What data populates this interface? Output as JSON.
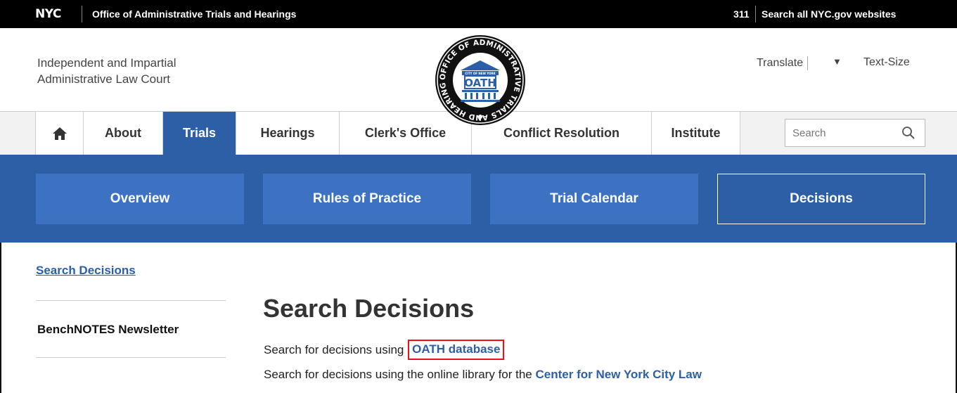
{
  "topbar": {
    "logo": "NYC",
    "agency": "Office of Administrative Trials and Hearings",
    "n311": "311",
    "search_all": "Search all NYC.gov websites"
  },
  "header": {
    "tagline_line1": "Independent and Impartial",
    "tagline_line2": "Administrative Law Court",
    "seal": {
      "ring_text": "OFFICE OF ADMINISTRATIVE TRIALS AND HEARINGS",
      "banner": "CITY OF NEW YORK",
      "center": "OATH"
    },
    "translate": "Translate",
    "translate_arrow": "▼",
    "text_size": "Text-Size"
  },
  "nav": {
    "home_icon": "home-icon",
    "items": [
      {
        "label": "About"
      },
      {
        "label": "Trials",
        "active": true
      },
      {
        "label": "Hearings"
      },
      {
        "label": "Clerk's Office"
      },
      {
        "label": "Conflict Resolution"
      },
      {
        "label": "Institute"
      }
    ],
    "search_placeholder": "Search",
    "search_icon": "magnifier-icon"
  },
  "subnav": {
    "items": [
      {
        "label": "Overview"
      },
      {
        "label": "Rules of Practice"
      },
      {
        "label": "Trial Calendar"
      },
      {
        "label": "Decisions",
        "selected": true
      }
    ]
  },
  "sidebar": {
    "link": "Search Decisions",
    "item": "BenchNOTES Newsletter"
  },
  "main": {
    "title": "Search Decisions",
    "line1_prefix": "Search for decisions using",
    "line1_link": "OATH database",
    "line2_prefix": "Search for decisions using the online library for the",
    "line2_link": "Center for New York City Law"
  },
  "colors": {
    "brand_blue": "#2d5fa6",
    "subnav_blue": "#3d72c2",
    "highlight_red": "#e11111"
  }
}
